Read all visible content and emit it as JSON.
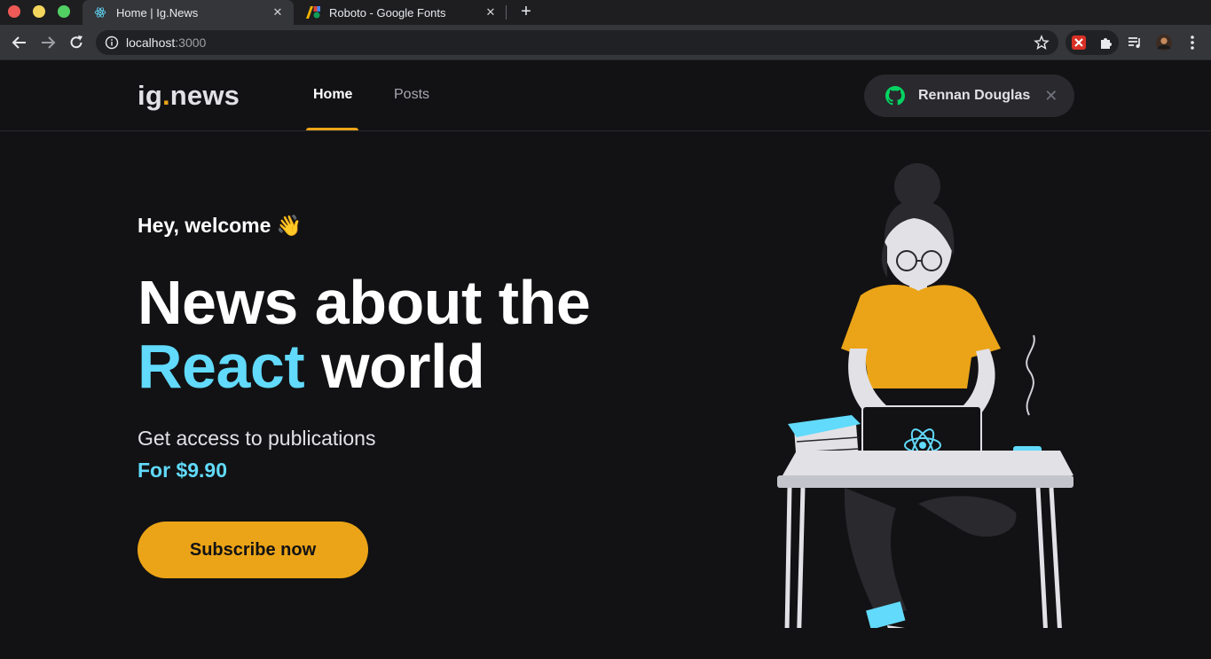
{
  "browser": {
    "tabs": [
      {
        "title": "Home | Ig.News",
        "favicon": "react-icon",
        "active": true
      },
      {
        "title": "Roboto - Google Fonts",
        "favicon": "google-fonts-icon",
        "active": false
      }
    ],
    "new_tab_label": "+",
    "close_label": "✕",
    "url_host": "localhost",
    "url_port": ":3000"
  },
  "header": {
    "logo_text": "ig",
    "logo_dot": ".",
    "logo_suffix": "news",
    "nav": [
      {
        "label": "Home",
        "active": true
      },
      {
        "label": "Posts",
        "active": false
      }
    ],
    "user_name": "Rennan Douglas",
    "signout_label": "✕"
  },
  "hero": {
    "welcome": "Hey, welcome 👋",
    "title_line1": "News about the",
    "title_highlight": "React",
    "title_rest": " world",
    "subtitle": "Get access to publications",
    "price": "For $9.90",
    "cta": "Subscribe now"
  },
  "colors": {
    "accent": "#eba417",
    "react_blue": "#61dafb",
    "background": "#121214"
  }
}
